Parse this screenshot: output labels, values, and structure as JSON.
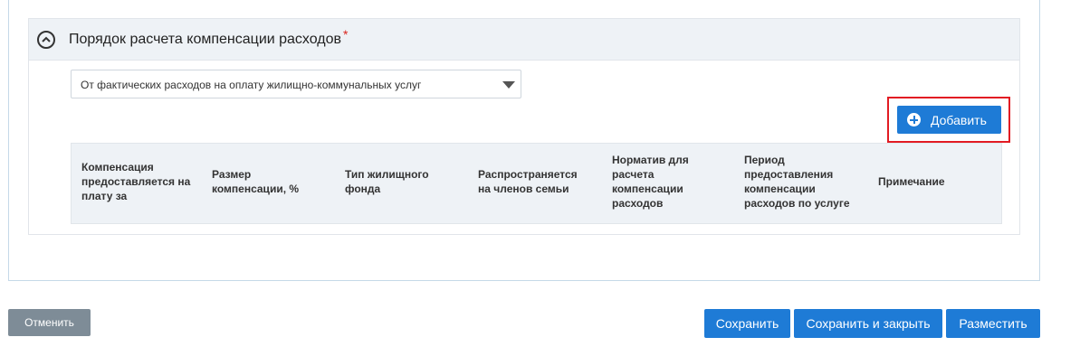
{
  "section": {
    "title": "Порядок расчета компенсации расходов",
    "required_mark": "*"
  },
  "calculation_select": {
    "value": "От фактических расходов на оплату жилищно-коммунальных услуг"
  },
  "add_button": {
    "label": "Добавить"
  },
  "table": {
    "columns": [
      "Компенсация предоставляется на плату за",
      "Размер компенсации, %",
      "Тип жилищного фонда",
      "Распространяется на членов семьи",
      "Норматив для расчета компенсации расходов",
      "Период предоставления компенсации расходов по услуге",
      "Примечание"
    ]
  },
  "footer": {
    "cancel_label": "Отменить",
    "save_label": "Сохранить",
    "save_close_label": "Сохранить и закрыть",
    "publish_label": "Разместить"
  },
  "colors": {
    "primary": "#1e7bd6",
    "cancel": "#7e8c97",
    "highlight": "#e21b23",
    "header_bg": "#eef2f6",
    "required": "#d9251d"
  }
}
